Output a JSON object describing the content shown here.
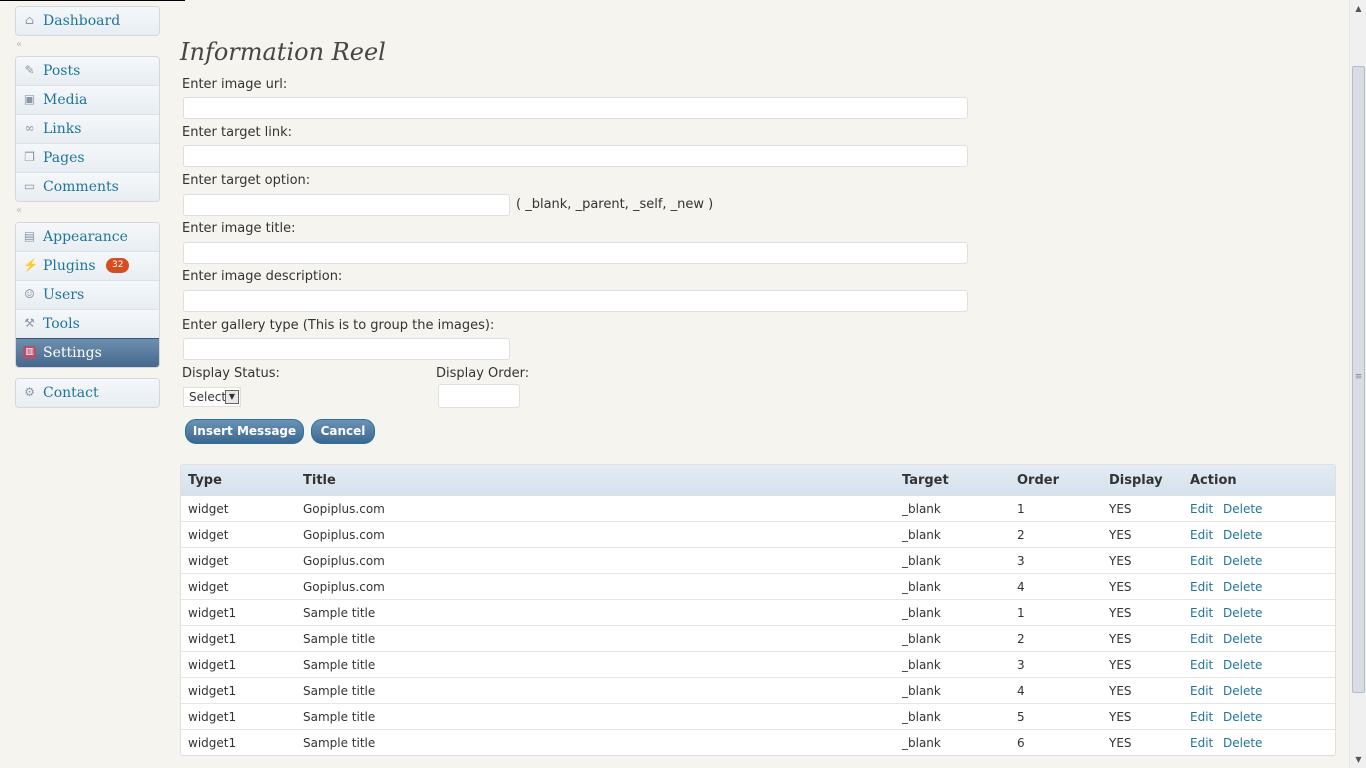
{
  "sidebar": {
    "dashboard": "Dashboard",
    "group1": [
      "Posts",
      "Media",
      "Links",
      "Pages",
      "Comments"
    ],
    "appearance": "Appearance",
    "plugins": "Plugins",
    "plugins_badge": "32",
    "users": "Users",
    "tools": "Tools",
    "settings": "Settings",
    "contact": "Contact"
  },
  "page": {
    "title": "Information Reel",
    "image_url_label": "Enter image url:",
    "target_link_label": "Enter target link:",
    "target_option_label": "Enter target option:",
    "target_option_hint": "( _blank, _parent, _self, _new )",
    "image_title_label": "Enter image title:",
    "image_description_label": "Enter image description:",
    "gallery_type_label": "Enter gallery type (This is to group the images):",
    "display_status_label": "Display Status:",
    "display_status_value": "Select",
    "display_order_label": "Display Order:",
    "insert_button": "Insert Message",
    "cancel_button": "Cancel"
  },
  "table": {
    "headers": [
      "Type",
      "Title",
      "Target",
      "Order",
      "Display",
      "Action"
    ],
    "rows": [
      {
        "type": "widget",
        "title": "Gopiplus.com",
        "target": "_blank",
        "order": "1",
        "display": "YES",
        "edit": "Edit",
        "delete": "Delete"
      },
      {
        "type": "widget",
        "title": "Gopiplus.com",
        "target": "_blank",
        "order": "2",
        "display": "YES",
        "edit": "Edit",
        "delete": "Delete"
      },
      {
        "type": "widget",
        "title": "Gopiplus.com",
        "target": "_blank",
        "order": "3",
        "display": "YES",
        "edit": "Edit",
        "delete": "Delete"
      },
      {
        "type": "widget",
        "title": "Gopiplus.com",
        "target": "_blank",
        "order": "4",
        "display": "YES",
        "edit": "Edit",
        "delete": "Delete"
      },
      {
        "type": "widget1",
        "title": "Sample title",
        "target": "_blank",
        "order": "1",
        "display": "YES",
        "edit": "Edit",
        "delete": "Delete"
      },
      {
        "type": "widget1",
        "title": "Sample title",
        "target": "_blank",
        "order": "2",
        "display": "YES",
        "edit": "Edit",
        "delete": "Delete"
      },
      {
        "type": "widget1",
        "title": "Sample title",
        "target": "_blank",
        "order": "3",
        "display": "YES",
        "edit": "Edit",
        "delete": "Delete"
      },
      {
        "type": "widget1",
        "title": "Sample title",
        "target": "_blank",
        "order": "4",
        "display": "YES",
        "edit": "Edit",
        "delete": "Delete"
      },
      {
        "type": "widget1",
        "title": "Sample title",
        "target": "_blank",
        "order": "5",
        "display": "YES",
        "edit": "Edit",
        "delete": "Delete"
      },
      {
        "type": "widget1",
        "title": "Sample title",
        "target": "_blank",
        "order": "6",
        "display": "YES",
        "edit": "Edit",
        "delete": "Delete"
      }
    ]
  },
  "colors": {
    "link": "#21759b",
    "active_menu": "#46698d",
    "badge": "#d54e21",
    "button": "#3b6791"
  }
}
